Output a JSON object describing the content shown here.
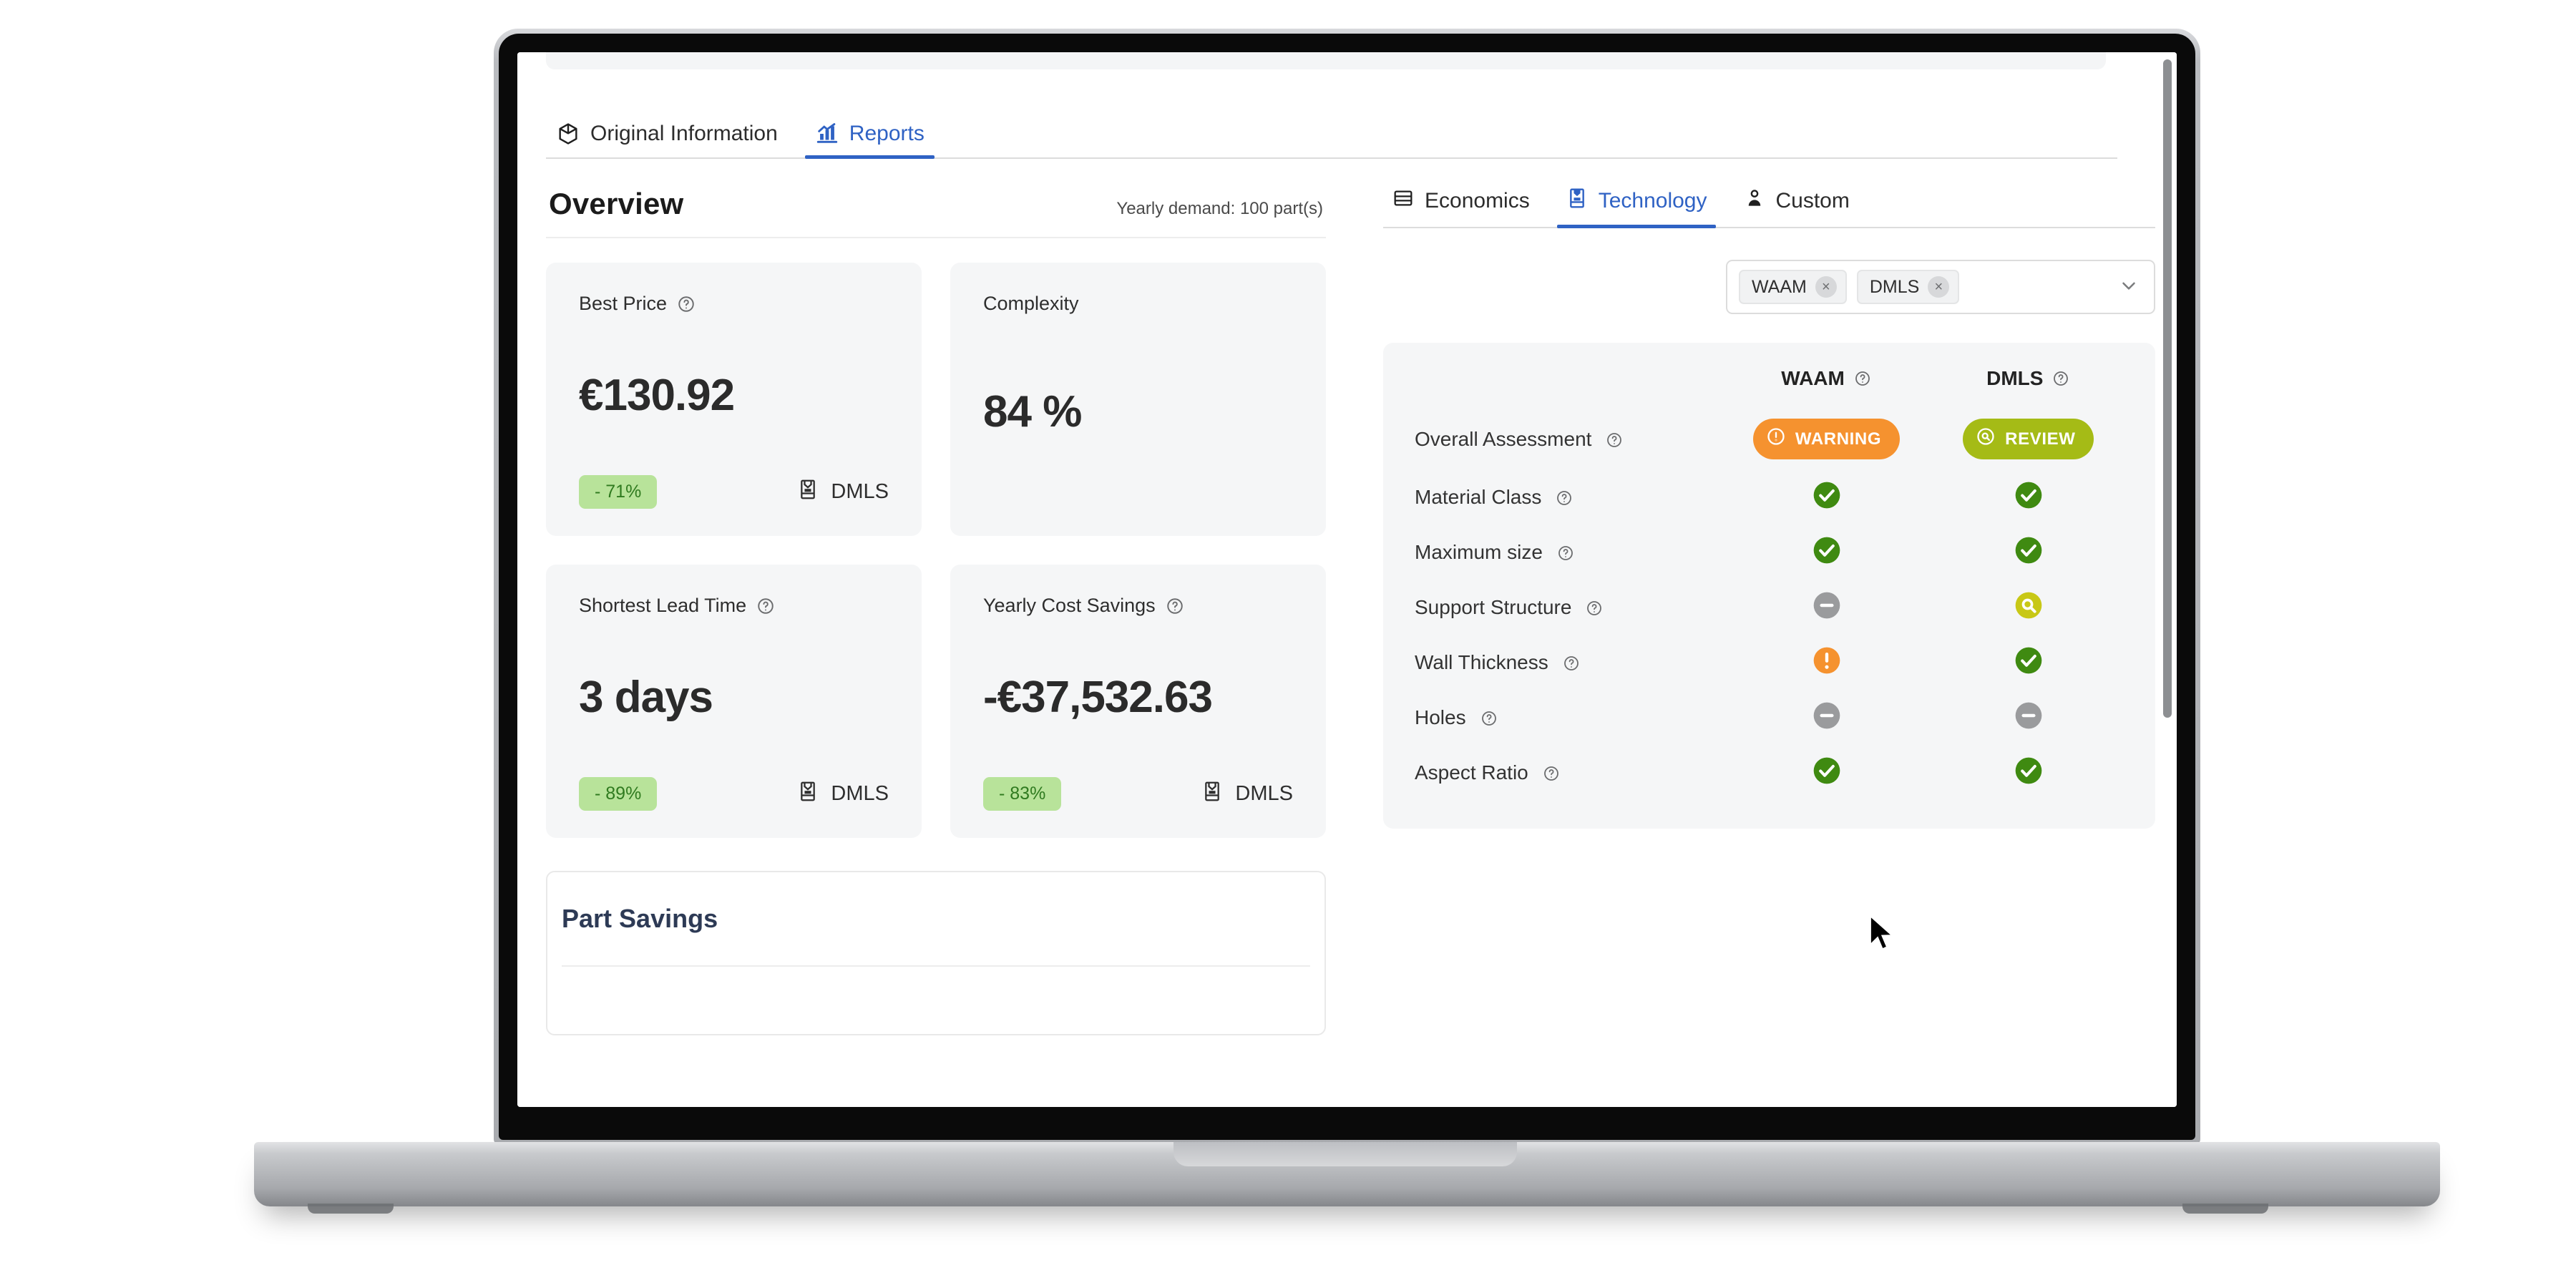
{
  "main_tabs": [
    {
      "label": "Original Information",
      "icon": "cube-icon",
      "active": false
    },
    {
      "label": "Reports",
      "icon": "bar-chart-icon",
      "active": true
    }
  ],
  "overview": {
    "title": "Overview",
    "yearly_demand": "Yearly demand: 100 part(s)",
    "kpis": [
      {
        "label": "Best Price",
        "has_info": true,
        "value": "€130.92",
        "delta": "- 71%",
        "technology": "DMLS",
        "tech_icon": "printer-icon"
      },
      {
        "label": "Complexity",
        "has_info": false,
        "value": "84 %",
        "delta": "",
        "technology": "",
        "tech_icon": ""
      },
      {
        "label": "Shortest Lead Time",
        "has_info": true,
        "value": "3 days",
        "delta": "- 89%",
        "technology": "DMLS",
        "tech_icon": "printer-icon"
      },
      {
        "label": "Yearly Cost Savings",
        "has_info": true,
        "value": "-€37,532.63",
        "delta": "- 83%",
        "technology": "DMLS",
        "tech_icon": "printer-icon"
      }
    ],
    "part_savings_title": "Part Savings"
  },
  "report_tabs": [
    {
      "label": "Economics",
      "icon": "economics-icon",
      "active": false
    },
    {
      "label": "Technology",
      "icon": "printer-icon",
      "active": true
    },
    {
      "label": "Custom",
      "icon": "person-icon",
      "active": false
    }
  ],
  "technology_select": {
    "chips": [
      {
        "label": "WAAM"
      },
      {
        "label": "DMLS"
      }
    ],
    "remove_glyph": "×",
    "caret_icon": "chevron-down-icon"
  },
  "technology_table": {
    "columns": [
      {
        "label": "WAAM",
        "has_info": true
      },
      {
        "label": "DMLS",
        "has_info": true
      }
    ],
    "rows": [
      {
        "criterion": "Overall Assessment",
        "has_info": true,
        "type": "badge",
        "waam": {
          "status": "warning",
          "label": "WARNING",
          "icon": "alert-circle-icon"
        },
        "dmls": {
          "status": "review",
          "label": "REVIEW",
          "icon": "magnifier-circle-icon"
        }
      },
      {
        "criterion": "Material Class",
        "has_info": true,
        "type": "icon",
        "waam": {
          "status": "pass",
          "icon": "check-circle-icon"
        },
        "dmls": {
          "status": "pass",
          "icon": "check-circle-icon"
        }
      },
      {
        "criterion": "Maximum size",
        "has_info": true,
        "type": "icon",
        "waam": {
          "status": "pass",
          "icon": "check-circle-icon"
        },
        "dmls": {
          "status": "pass",
          "icon": "check-circle-icon"
        }
      },
      {
        "criterion": "Support Structure",
        "has_info": true,
        "type": "icon",
        "waam": {
          "status": "na",
          "icon": "minus-circle-icon"
        },
        "dmls": {
          "status": "review",
          "icon": "magnifier-circle-icon"
        }
      },
      {
        "criterion": "Wall Thickness",
        "has_info": true,
        "type": "icon",
        "waam": {
          "status": "warning",
          "icon": "exclamation-circle-icon"
        },
        "dmls": {
          "status": "pass",
          "icon": "check-circle-icon"
        }
      },
      {
        "criterion": "Holes",
        "has_info": true,
        "type": "icon",
        "waam": {
          "status": "na",
          "icon": "minus-circle-icon"
        },
        "dmls": {
          "status": "na",
          "icon": "minus-circle-icon"
        }
      },
      {
        "criterion": "Aspect Ratio",
        "has_info": true,
        "type": "icon",
        "waam": {
          "status": "pass",
          "icon": "check-circle-icon"
        },
        "dmls": {
          "status": "pass",
          "icon": "check-circle-icon"
        }
      }
    ]
  },
  "colors": {
    "accent": "#2f62c4",
    "pass": "#3f8a11",
    "warning": "#f5922f",
    "review": "#c8c816",
    "na": "#9a9b9d",
    "chip_green_bg": "#b8e39a",
    "chip_green_text": "#2f7a1f",
    "card_bg": "#f5f6f7",
    "part_savings_text": "#2d3a55"
  }
}
